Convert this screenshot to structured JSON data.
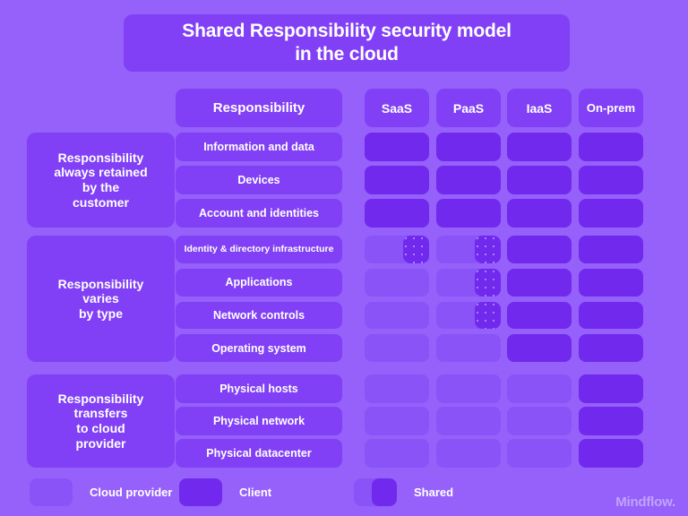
{
  "title": "Shared Responsibility security model\nin the cloud",
  "header": {
    "responsibility_label": "Responsibility",
    "columns": [
      "SaaS",
      "PaaS",
      "IaaS",
      "On-prem"
    ]
  },
  "groups": [
    {
      "category": "Responsibility\nalways retained\nby the\ncustomer",
      "rows": [
        {
          "label": "Information and data",
          "cells": [
            "client",
            "client",
            "client",
            "client"
          ]
        },
        {
          "label": "Devices",
          "cells": [
            "client",
            "client",
            "client",
            "client"
          ]
        },
        {
          "label": "Account and identities",
          "cells": [
            "client",
            "client",
            "client",
            "client"
          ]
        }
      ]
    },
    {
      "category": "Responsibility\nvaries\nby type",
      "rows": [
        {
          "label": "Identity & directory infrastructure",
          "small": true,
          "cells": [
            "shared",
            "shared",
            "client",
            "client"
          ]
        },
        {
          "label": "Applications",
          "cells": [
            "provider",
            "shared",
            "client",
            "client"
          ]
        },
        {
          "label": "Network controls",
          "cells": [
            "provider",
            "shared",
            "client",
            "client"
          ]
        },
        {
          "label": "Operating system",
          "cells": [
            "provider",
            "provider",
            "client",
            "client"
          ]
        }
      ]
    },
    {
      "category": "Responsibility\ntransfers\nto cloud\nprovider",
      "rows": [
        {
          "label": "Physical hosts",
          "cells": [
            "provider",
            "provider",
            "provider",
            "client"
          ]
        },
        {
          "label": "Physical network",
          "cells": [
            "provider",
            "provider",
            "provider",
            "client"
          ]
        },
        {
          "label": "Physical datacenter",
          "cells": [
            "provider",
            "provider",
            "provider",
            "client"
          ]
        }
      ]
    }
  ],
  "legend": [
    {
      "kind": "provider",
      "label": "Cloud provider"
    },
    {
      "kind": "client",
      "label": "Client"
    },
    {
      "kind": "shared",
      "label": "Shared"
    }
  ],
  "watermark": "Mindflow.",
  "colors": {
    "background": "#9561fa",
    "card": "#8140f5",
    "provider": "#8a53f8",
    "client": "#7129ee",
    "text": "#ffffff"
  }
}
